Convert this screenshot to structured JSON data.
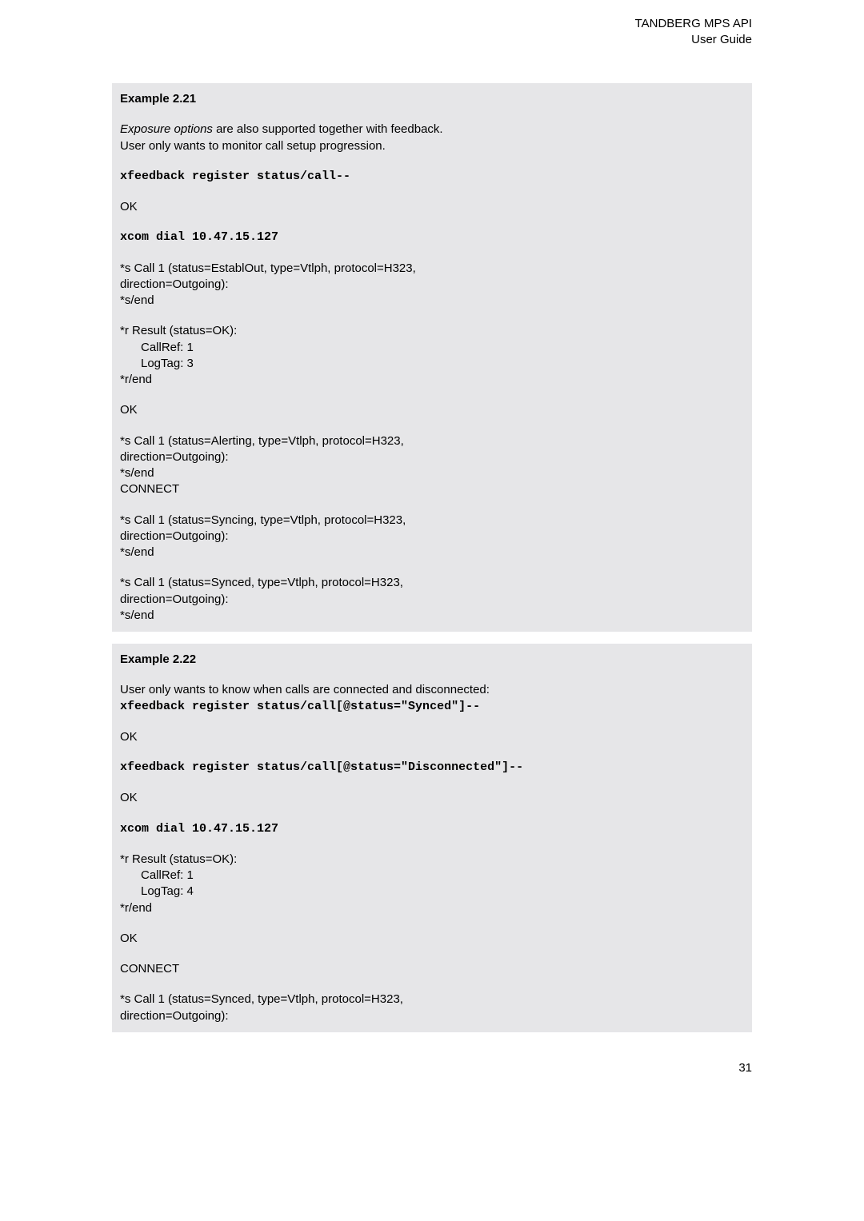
{
  "header": {
    "line1": "TANDBERG MPS API",
    "line2": "User Guide"
  },
  "example21": {
    "title": "Example 2.21",
    "p1a": "Exposure options",
    "p1b": " are also supported together with feedback.",
    "p2": "User only wants to monitor call setup progression.",
    "cmd1": "xfeedback register status/call--",
    "ok1": "OK",
    "cmd2": "xcom dial 10.47.15.127",
    "s1a": "*s Call 1 (status=EstablOut, type=Vtlph, protocol=H323,",
    "s1b": "direction=Outgoing):",
    "s1c": "*s/end",
    "r1a": "*r Result (status=OK):",
    "r1b": "CallRef: 1",
    "r1c": "LogTag: 3",
    "r1d": "*r/end",
    "ok2": "OK",
    "s2a": "*s Call 1 (status=Alerting, type=Vtlph, protocol=H323,",
    "s2b": "direction=Outgoing):",
    "s2c": "*s/end",
    "s2d": "CONNECT",
    "s3a": "*s Call 1 (status=Syncing, type=Vtlph, protocol=H323,",
    "s3b": "direction=Outgoing):",
    "s3c": "*s/end",
    "s4a": "*s Call 1 (status=Synced, type=Vtlph, protocol=H323,",
    "s4b": "direction=Outgoing):",
    "s4c": "*s/end"
  },
  "example22": {
    "title": "Example 2.22",
    "p1": "User only wants to know when calls are connected and disconnected:",
    "cmd1": "xfeedback register status/call[@status=\"Synced\"]--",
    "ok1": "OK",
    "cmd2": "xfeedback register status/call[@status=\"Disconnected\"]--",
    "ok2": "OK",
    "cmd3": "xcom dial 10.47.15.127",
    "r1a": "*r Result (status=OK):",
    "r1b": "CallRef: 1",
    "r1c": "LogTag: 4",
    "r1d": "*r/end",
    "ok3": "OK",
    "conn": "CONNECT",
    "s1a": "*s Call 1 (status=Synced, type=Vtlph, protocol=H323,",
    "s1b": "direction=Outgoing):"
  },
  "page_number": "31"
}
